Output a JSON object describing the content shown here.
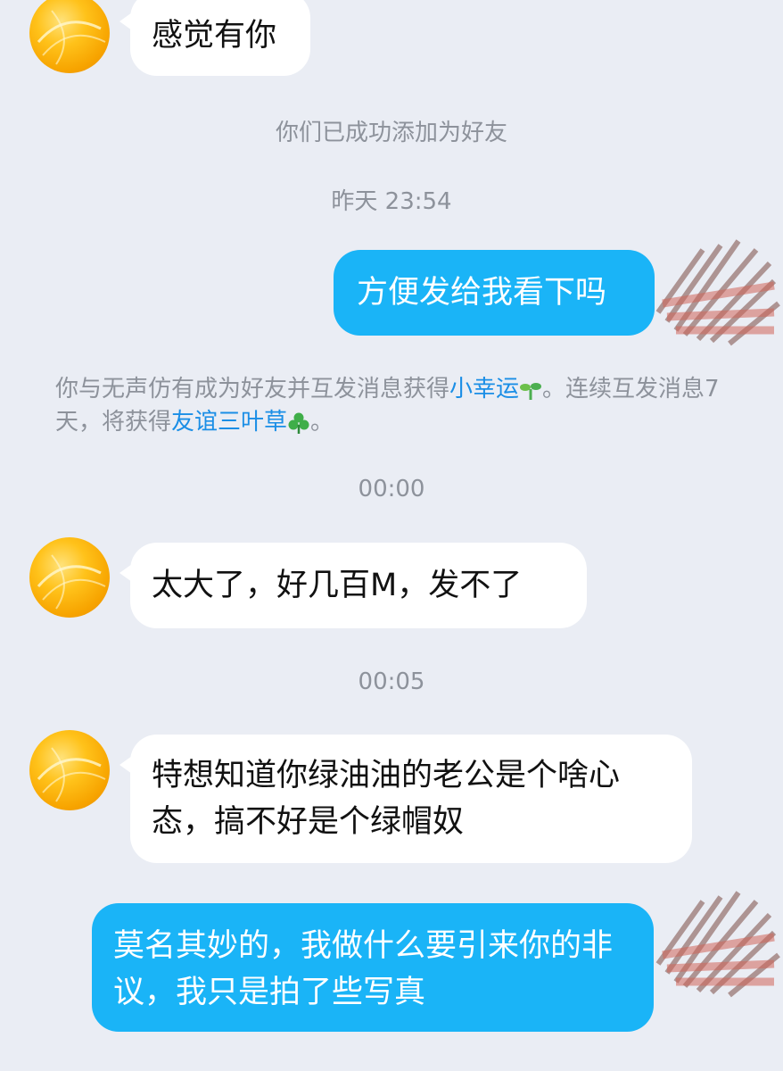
{
  "messages": [
    {
      "side": "left",
      "text": "感觉有你"
    },
    {
      "system": "你们已成功添加为好友"
    },
    {
      "time": "昨天 23:54"
    },
    {
      "side": "right",
      "text": "方便发给我看下吗"
    },
    {
      "notice_parts": [
        "你与无声仿有成为好友并互发消息获得",
        "小幸运",
        "。连续互发消息7天，将获得",
        "友谊三叶草",
        "。"
      ]
    },
    {
      "time": "00:00"
    },
    {
      "side": "left",
      "text": "太大了，好几百M，发不了"
    },
    {
      "time": "00:05"
    },
    {
      "side": "left",
      "text": "特想知道你绿油油的老公是个啥心态，搞不好是个绿帽奴"
    },
    {
      "side": "right",
      "text": "莫名其妙的，我做什么要引来你的非议，我只是拍了些写真"
    }
  ],
  "icons": {
    "avatar": "orange-ball-avatar",
    "sprout": "sprout-icon",
    "clover": "clover-icon"
  },
  "colors": {
    "background": "#eaedf4",
    "outgoing_bubble": "#1ab4f7",
    "incoming_bubble": "#ffffff",
    "link": "#1a8ee6",
    "system_text": "#8d929b"
  }
}
